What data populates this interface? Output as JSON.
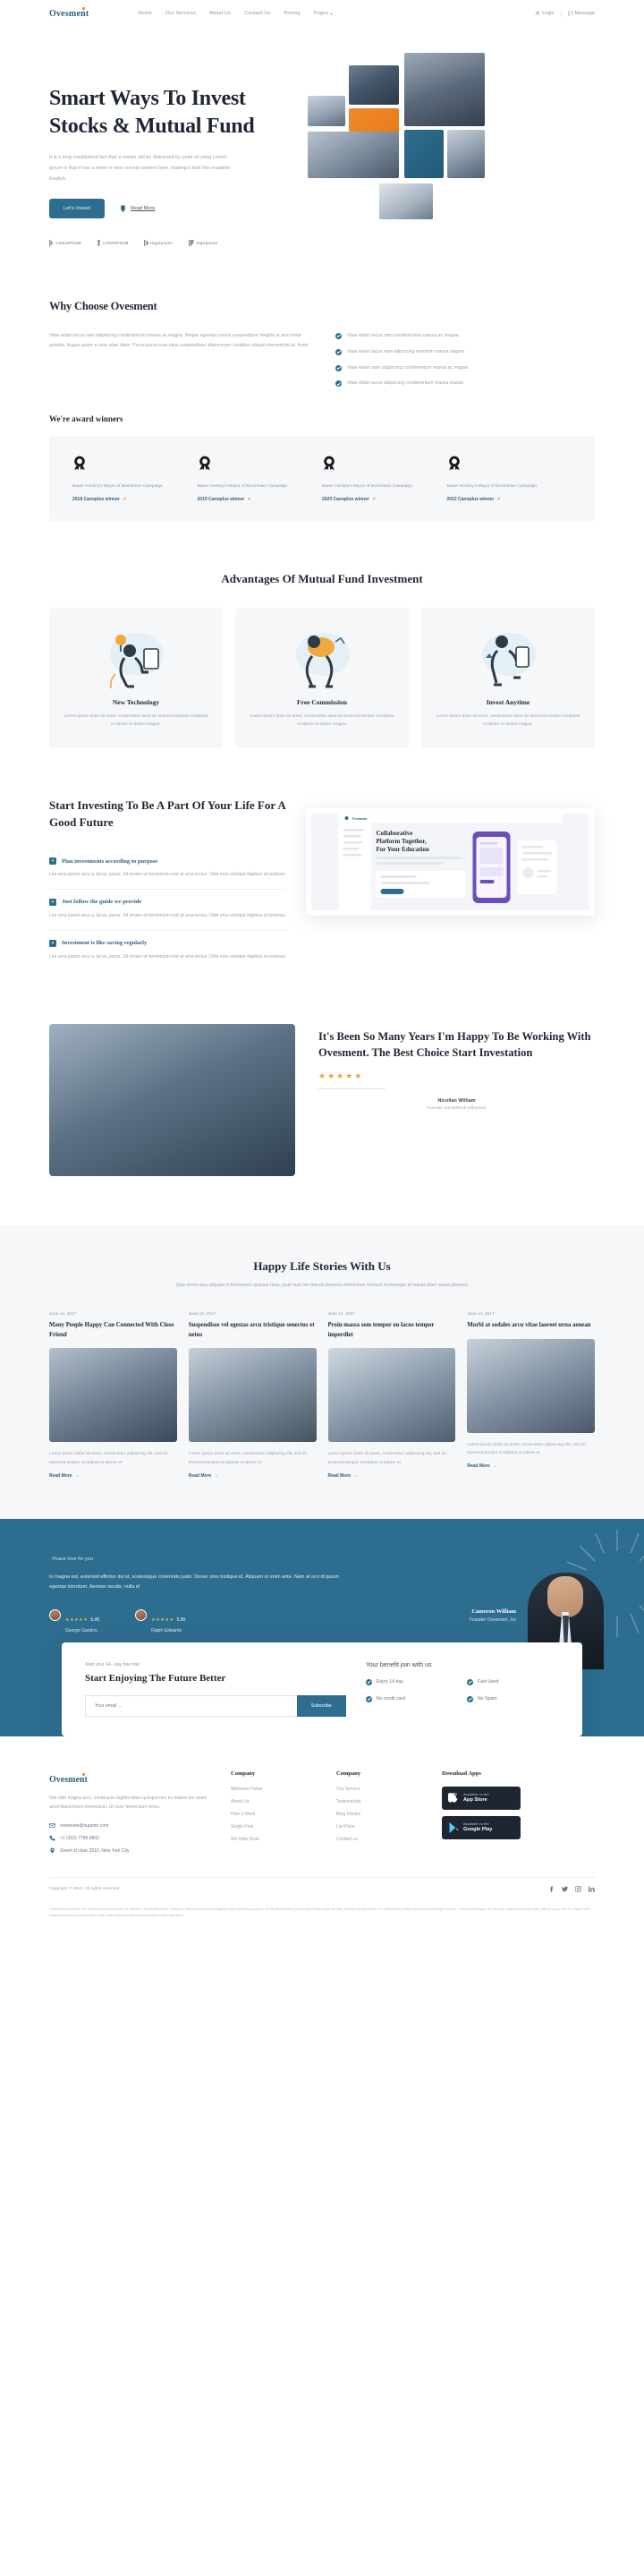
{
  "brand": {
    "name": "Ovesment"
  },
  "nav": {
    "items": [
      {
        "label": "Home"
      },
      {
        "label": "Our Services"
      },
      {
        "label": "About Us"
      },
      {
        "label": "Contact Us"
      },
      {
        "label": "Pricing"
      },
      {
        "label": "Pages",
        "caret": "▾"
      }
    ],
    "login": "Login",
    "message": "Message"
  },
  "hero": {
    "title": "Smart Ways To Invest Stocks & Mutual Fund",
    "desc": "It is a long established fact that a reader will be distracted by point of using Lorem ipsum is that it has a more-or-less normal content here, making it look like readable English.",
    "cta_primary": "Let's Invest",
    "cta_secondary": "Read More",
    "logos": [
      {
        "label": "LOGOIPSUM"
      },
      {
        "label": "LOGOIPSUM"
      },
      {
        "label": "logoipsum°"
      },
      {
        "label": "logoipsum"
      }
    ]
  },
  "why": {
    "title": "Why Choose Ovesment",
    "paragraph": "Vitae etiam lacus nam adipiscing condimentum massa ac magna. Neque egestas cursus suspendisse fringilla ut sem tortor gravida. Augue quam a urna vitae diam. Purus purus cras risus suspendisse ullamcorper curabitur aliquet elementum at. Amet",
    "list": [
      "Vitae etiam lacus nam condimentum massa ac magna",
      "Vitae etiam lacus nam adipiscing imentum massa magna",
      "Vitae etiam nam adipiscing condimentum massa ac magna",
      "Vitae etiam lacus adipiscing condimentum massa massa"
    ]
  },
  "awards": {
    "title": "We're award winners",
    "cards": [
      {
        "text": "Bauer Hockey's Mayor of Boomtown Campaign",
        "winner": "2018 Canoplus winner"
      },
      {
        "text": "Bauer Hockey's Mayor of Boomtown Campaign",
        "winner": "2019 Canoplus winner"
      },
      {
        "text": "Bauer Hockey's Mayor of Boomtown Campaign",
        "winner": "2020 Canoplus winner"
      },
      {
        "text": "Bauer Hockey's Mayor of Boomtown Campaign",
        "winner": "2022 Canoplus winner"
      }
    ]
  },
  "advantages": {
    "title": "Advantages Of Mutual Fund Investment",
    "cards": [
      {
        "heading": "New Technology",
        "text": "Lorem ipsum dolor sit amet, consectetur ased do eiusmod tempor incididunt ut labore et dolore magna."
      },
      {
        "heading": "Free Commission",
        "text": "Lorem ipsum dolor sit amet, consectetur ased do eiusmod tempor incididunt ut labore et dolore magna."
      },
      {
        "heading": "Invest Anytime",
        "text": "Lorem ipsum dolor sit amet, consectetur ased do eiusmod tempor incididunt ut labore et dolore magna."
      }
    ]
  },
  "start": {
    "title": "Start Investing To Be A Part Of Your Life For A Good Future",
    "items": [
      {
        "heading": "Plan investments according to purpose",
        "text": "Leo urna ipsum arcu a, lacus, purus. Sit ornare ut fermentum erat at urna lectus. Odio eros volutpat dapibus sit pulvinar."
      },
      {
        "heading": "Just follow the guide we provide",
        "text": "Leo urna ipsum arcu a, lacus, purus. Sit ornare ut fermentum erat at urna lectus. Odio eros volutpat dapibus sit pulvinar."
      },
      {
        "heading": "Investment is like saving regularly",
        "text": "Leo urna ipsum arcu a, lacus, purus. Sit ornare ut fermentum erat at urna lectus. Odio eros volutpat dapibus sit pulvinar."
      }
    ],
    "dashboard": {
      "brand": "Ovesment",
      "heading": "Collaborative Platform Together, For Your Education"
    }
  },
  "testimonial": {
    "title": "It's Been So Many Years I'm Happy To Be Working With Ovesment. The Best Choice Start Investation",
    "stars": "★★★★★",
    "name": "Nicollan William",
    "role": "Founder, Kensoftech Influencer"
  },
  "blog": {
    "title": "Happy Life Stories With Us",
    "subtitle": "Quis lorem arcu aliquam in fermentum quisque risus, justo nunc leo blandit pharetra elementum rhoncus scelerisque at mauris diam varius pharetra",
    "read_more": "Read More",
    "posts": [
      {
        "date": "June 14, 2017",
        "heading": "Many People Happy Can Connected With Close Friend",
        "text": "Lorem ipsum dolor sit amet, consectetur adipiscing elit, sed do eiusmod tempor incididunt ut labore et"
      },
      {
        "date": "June 14, 2017",
        "heading": "Suspendisse vel egestas arcu tristique senectus et netus",
        "text": "Lorem ipsum dolor sit amet, consectetur adipiscing elit, sed do eiusmod tempor incididunt ut labore et"
      },
      {
        "date": "June 14, 2017",
        "heading": "Proin massa sem tempor eu lacus tempor imperdiet",
        "text": "Lorem ipsum dolor sit amet, consectetur adipiscing elit, sed do eiusmod tempor incididunt ut labore et"
      },
      {
        "date": "June 14, 2017",
        "heading": "Morbi at sodales arcu vitae laoreet urna aenean",
        "text": "Lorem ipsum dolor sit amet, consectetur adipiscing elit, sed do eiusmod tempor incididunt ut labore et"
      }
    ]
  },
  "cta": {
    "kicker": "- Peace love for you",
    "paragraph": "In magna est, euismod efficitur dui id, scelerisque commodo justo. Donec sino tristique id. Aliquam ut enim ante. Nam at orci id ipsum egestas interdum. Aenean iaculis, nulla id",
    "reviews": [
      {
        "stars": "★★★★★",
        "score": "5.00",
        "name": "George Gandos"
      },
      {
        "stars": "★★★★★",
        "score": "5.00",
        "name": "Ralph Edwards"
      }
    ],
    "person_name": "Cameron William",
    "person_role": "Founder Ovesment, Inc"
  },
  "newsletter": {
    "kicker": "Start your 14 - day free trial",
    "heading": "Start Enjoying The Future Better",
    "placeholder": "Your email ...",
    "button": "Subscribe",
    "benefits_title": "Your benefit join with us",
    "benefits": [
      "Enjoy 14 day",
      "Fast Used",
      "No credit card",
      "No Spam"
    ]
  },
  "footer": {
    "brand": "Ovesment",
    "desc": "Nisi nibh magna arcu, consequat sagittis tellus quisque nec eu mauris leo quam amet bland lorem fermentum. Ut nunc fermentum netus.",
    "contacts": [
      {
        "icon": "mail-icon",
        "text": "ovesment@support.com"
      },
      {
        "icon": "phone-icon",
        "text": "+1 (202) 7789 8802"
      },
      {
        "icon": "pin-icon",
        "text": "Street of clear 2910, New York City"
      }
    ],
    "columns": [
      {
        "title": "Company",
        "links": [
          "Welcome Home",
          "About Us",
          "How It Work",
          "Single Post",
          "We Help Desk"
        ]
      },
      {
        "title": "Company",
        "links": [
          "Our Service",
          "Testimonials",
          "Blog Stories",
          "List Price",
          "Contact us"
        ]
      }
    ],
    "apps_title": "Download Apps",
    "stores": [
      {
        "small": "Available on the",
        "big": "App Store",
        "icon": "apple-icon"
      },
      {
        "small": "Available on the",
        "big": "Google Play",
        "icon": "play-icon"
      }
    ],
    "copyright": "Copyright © 2022. All rights reserved",
    "socials": [
      "facebook-icon",
      "twitter-icon",
      "instagram-icon",
      "linkedin-icon"
    ],
    "note": "Ovesment Innovation, Inc. Ovesment product prices are offered in the United States. Sample et aliquet posuere urna sagittis massa adipiscing dapibus. Sit blandit habitasse proin purus integer quam sit vitae. Elit sed nisi elementum sit. Pellentesque mattis auctor rhoncus integer amet in. Cursus pellentesque mi nisi enim. Malesuada in sed vitae, felis ac quam sit in eu. Aliquet nibh elementum rhoncus gravida nam. Duis, nulla unde amet libero porta tincidunt mollis odio quam."
  }
}
